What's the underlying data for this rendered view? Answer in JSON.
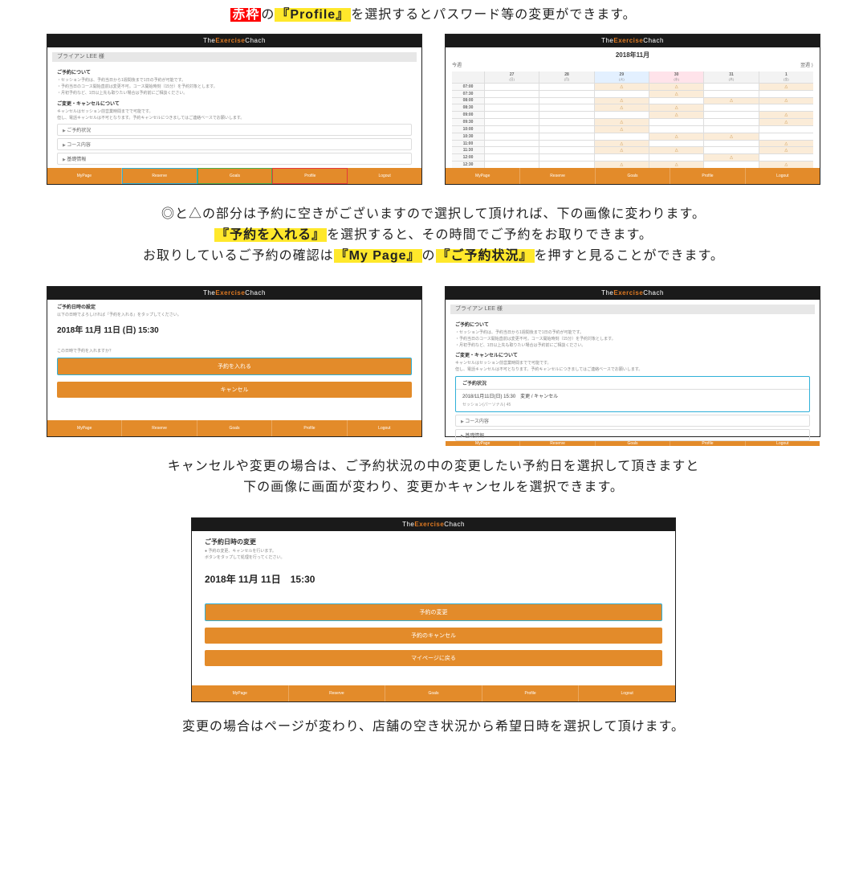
{
  "brand": {
    "left": "The",
    "mid": "Exercise",
    "right": "Chach"
  },
  "intro": {
    "red": "赤枠",
    "a": "の",
    "profile": "『Profile』",
    "b": "を選択するとパスワード等の変更ができます。"
  },
  "footer": [
    "MyPage",
    "Reserve",
    "Goals",
    "Profile",
    "Logout"
  ],
  "shot1": {
    "grey": "ブライアン LEE 様",
    "h1": "ご予約について",
    "lines": [
      "・セッション予約は、予約当日から1週間後まで1日の予約が可能です。",
      "・予約当日のコース開始直前は変更不可。コース開始時刻（15分）を予約対象とします。",
      "・月初予約など、1日以上先も取りたい場合は予約前にご相談ください。"
    ],
    "h2": "ご変更・キャンセルについて",
    "lines2": [
      "キャンセルはセッション前営業時間までで可能です。",
      "但し、電話キャンセルは不可となります。予約キャンセルにつきましてはご連絡ベースでお願いします。"
    ],
    "acc": [
      "ご予約状況",
      "コース内容",
      "基礎情報"
    ]
  },
  "shot2": {
    "title": "2018年11月",
    "prev": "今週",
    "next": "翌週 ⟩",
    "days": [
      {
        "d": "27",
        "w": "(日)"
      },
      {
        "d": "28",
        "w": "(月)"
      },
      {
        "d": "29",
        "w": "(火)"
      },
      {
        "d": "30",
        "w": "(水)"
      },
      {
        "d": "31",
        "w": "(木)"
      },
      {
        "d": "1",
        "w": "(金)"
      }
    ],
    "times": [
      "07:00",
      "07:30",
      "08:00",
      "08:30",
      "09:00",
      "09:30",
      "10:00",
      "10:30",
      "11:00",
      "11:30",
      "12:00",
      "12:30"
    ]
  },
  "para2": {
    "a": "◎と△の部分は予約に空きがございますので選択して頂ければ、下の画像に変わります。",
    "b1": "『予約を入れる』",
    "b2": "を選択すると、その時間でご予約をお取りできます。",
    "c1": "お取りしているご予約の確認は",
    "c2": "『My Page』",
    "c3": "の",
    "c4": "『ご予約状況』",
    "c5": "を押すと見ることができます。"
  },
  "shot3": {
    "h": "ご予約日時の設定",
    "sub": "以下の日時でよろしければ『予約を入れる』をタップしてください。",
    "date": "2018年 11月 11日 (日) 15:30",
    "q": "この日時で予約を入れますか？",
    "btn1": "予約を入れる",
    "btn2": "キャンセル"
  },
  "shot4": {
    "grey": "ブライアン LEE 様",
    "h1": "ご予約について",
    "lines": [
      "・セッション予約は、予約当日から1週間後まで1日の予約が可能です。",
      "・予約当日のコース開始直前は変更不可。コース開始時刻（15分）を予約対象とします。",
      "・月初予約など、1日以上先も取りたい場合は予約前にご相談ください。"
    ],
    "h2": "ご変更・キャンセルについて",
    "lines2": [
      "キャンセルはセッション前営業時間までで可能です。",
      "但し、電話キャンセルは不可となります。予約キャンセルにつきましてはご連絡ベースでお願いします。"
    ],
    "accHead": "ご予約状況",
    "accBody": "2018/11月11日(日) 15:30　変更 / キャンセル",
    "accNote": "セッション(パーソナル) 45",
    "acc2": "コース内容",
    "acc3": "基礎情報"
  },
  "para3": "キャンセルや変更の場合は、ご予約状況の中の変更したい予約日を選択して頂きますと\n下の画像に画面が変わり、変更かキャンセルを選択できます。",
  "shot5": {
    "h": "ご予約日時の変更",
    "sub": [
      "● 予約の変更、キャンセルを行います。",
      "   ボタンをタップして処理を行ってください。"
    ],
    "date": "2018年 11月 11日　15:30",
    "btn1": "予約の変更",
    "btn2": "予約のキャンセル",
    "btn3": "マイページに戻る"
  },
  "para4": "変更の場合はページが変わり、店舗の空き状況から希望日時を選択して頂けます。"
}
